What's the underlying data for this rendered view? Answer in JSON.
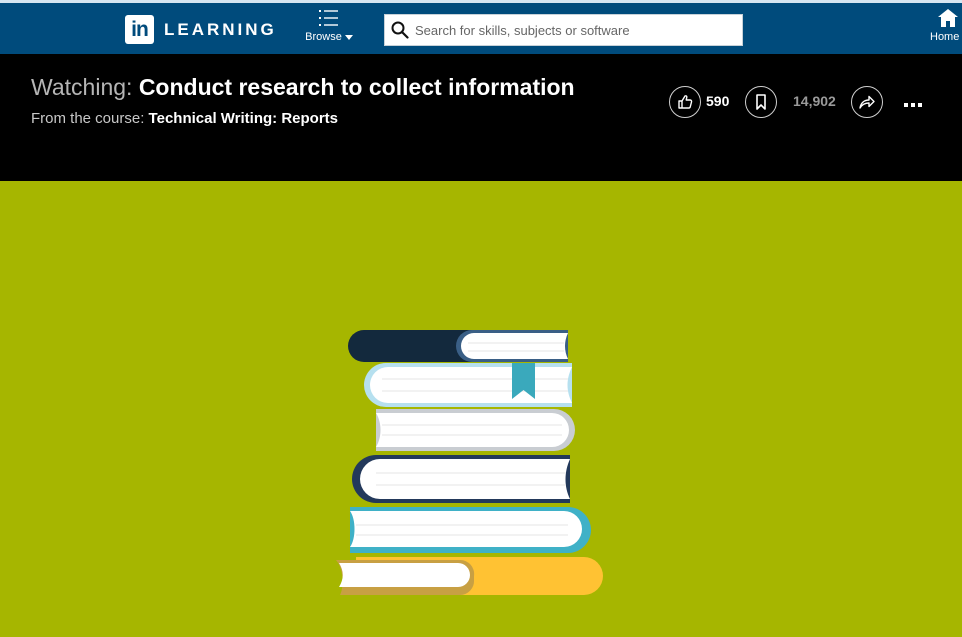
{
  "nav": {
    "logo_mark": "in",
    "logo_text": "LEARNING",
    "browse_label": "Browse",
    "search_placeholder": "Search for skills, subjects or software",
    "search_value": "",
    "home_label": "Home"
  },
  "header": {
    "title_prefix": "Watching:",
    "title": "Conduct research to collect information",
    "subtitle_prefix": "From the course:",
    "course": "Technical Writing: Reports",
    "likes": "590",
    "saves": "14,902"
  },
  "colors": {
    "nav_bg": "#004b7c",
    "header_bg": "#000000",
    "video_bg": "#a6b600",
    "book_dark": "#13293d",
    "book_light_blue": "#b6e0ef",
    "book_grey": "#c9cdd2",
    "book_navy": "#23395b",
    "book_teal": "#3fb1c7",
    "book_yellow": "#ffc233",
    "bookmark": "#3aa9bc"
  },
  "icons": {
    "browse": "list-icon",
    "search": "search-icon",
    "home": "home-icon",
    "like": "thumbs-up-icon",
    "save": "bookmark-icon",
    "share": "share-icon",
    "more": "more-dots-icon"
  }
}
